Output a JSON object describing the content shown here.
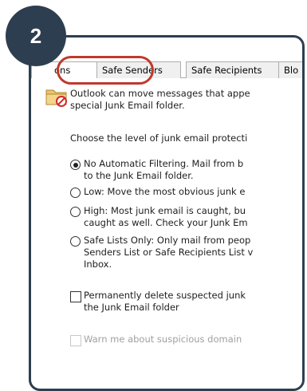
{
  "step_badge": "2",
  "tabs": [
    {
      "label": "ons"
    },
    {
      "label": "Safe Senders"
    },
    {
      "label": "Safe Recipients"
    },
    {
      "label": "Blo"
    }
  ],
  "intro": {
    "line1": "Outlook can move messages that appe",
    "line2": "special Junk Email folder."
  },
  "level_prompt": "Choose the level of junk email protecti",
  "options": [
    {
      "line1": "No Automatic Filtering. Mail from b",
      "line2": "to the Junk Email folder.",
      "checked": true
    },
    {
      "line1": "Low: Move the most obvious junk e",
      "line2": "",
      "checked": false
    },
    {
      "line1": "High: Most junk email is caught, bu",
      "line2": "caught as well. Check your Junk Em",
      "checked": false
    },
    {
      "line1": "Safe Lists Only: Only mail from peop",
      "line2": "Senders List or Safe Recipients List v",
      "line3": "Inbox.",
      "checked": false
    }
  ],
  "permanent_delete": {
    "line1": "Permanently delete suspected junk",
    "line2": "the Junk Email folder",
    "checked": false
  },
  "warn": {
    "label": "Warn me about suspicious domain",
    "checked": false
  },
  "colors": {
    "badge": "#2d3e50",
    "highlight": "#c0392b"
  },
  "icons": {
    "folder": "junk-folder-icon"
  }
}
